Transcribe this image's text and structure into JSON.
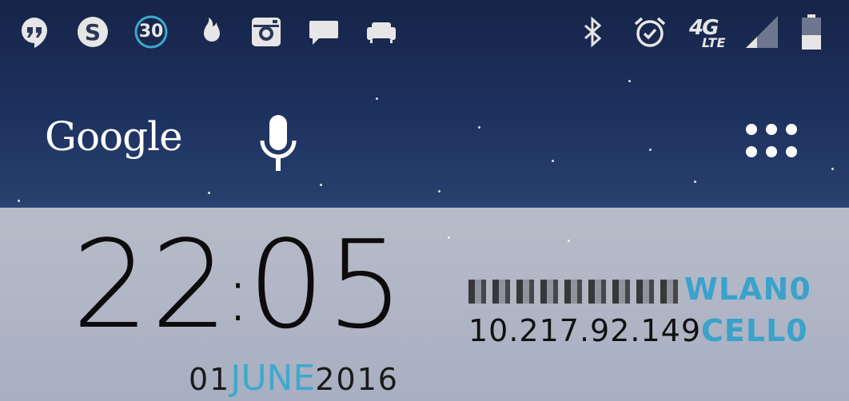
{
  "status_bar": {
    "left_icons": [
      "hangouts-icon",
      "skype-icon",
      "calendar-badge-icon",
      "tinder-icon",
      "instagram-icon",
      "chat-icon",
      "sofa-icon"
    ],
    "calendar_badge": "30",
    "right_icons": [
      "bluetooth-icon",
      "alarm-icon",
      "4g-lte-icon",
      "signal-icon",
      "battery-icon"
    ],
    "network_type": "4G",
    "network_sub": "LTE"
  },
  "google_bar": {
    "logo_text": "Google",
    "mic_icon": "microphone-icon",
    "apps_icon": "app-drawer-icon"
  },
  "clock_widget": {
    "hours": "22",
    "colon": ":",
    "minutes": "05",
    "day": "01",
    "month": "JUNE",
    "year": "2016"
  },
  "network_widget": {
    "wlan_label": "WLAN0",
    "cell_ip": "10.217.92.149",
    "cell_label": "CELL0"
  },
  "colors": {
    "accent": "#3ea8cf",
    "panel": "#b4b9c7"
  }
}
